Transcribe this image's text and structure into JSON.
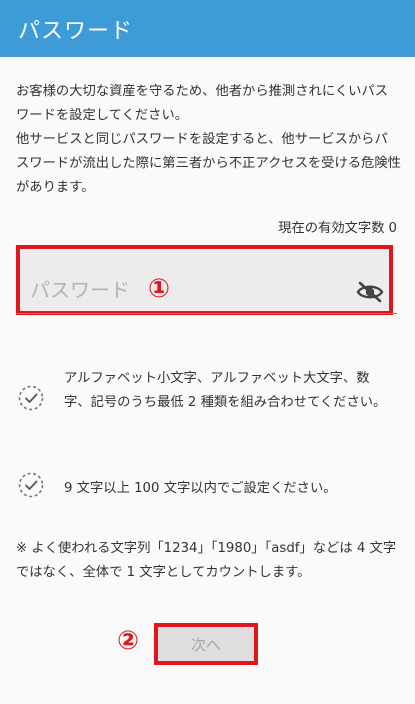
{
  "header": {
    "title": "パスワード"
  },
  "intro": {
    "paragraph1": "お客様の大切な資産を守るため、他者から推測されにくいパスワードを設定してください。",
    "paragraph2": "他サービスと同じパスワードを設定すると、他サービスからパスワードが流出した際に第三者から不正アクセスを受ける危険性があります。"
  },
  "counter": {
    "label": "現在の有効文字数",
    "value": "0"
  },
  "password_field": {
    "placeholder": "パスワード",
    "value": "",
    "marker": "①",
    "toggle_icon": "eye-off-icon"
  },
  "requirements": [
    {
      "text": "アルファベット小文字、アルファベット大文字、数字、記号のうち最低 2 種類を組み合わせてください。",
      "icon": "dashed-check-circle-icon"
    },
    {
      "text": "9 文字以上 100 文字以内でご設定ください。",
      "icon": "dashed-check-circle-icon"
    }
  ],
  "note": "※ よく使われる文字列「1234」「1980」「asdf」などは 4 文字ではなく、全体で 1 文字としてカウントします。",
  "footer": {
    "marker": "②",
    "next_label": "次へ"
  },
  "colors": {
    "header": "#3f9bd7",
    "highlight": "#e0161d",
    "field_bg": "#ececec",
    "button_bg": "#dedede"
  }
}
